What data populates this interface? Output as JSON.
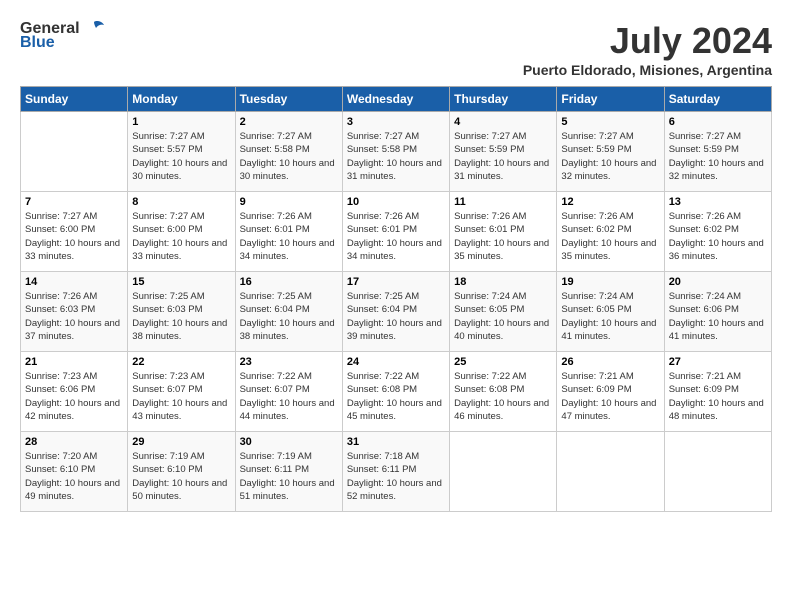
{
  "logo": {
    "general": "General",
    "blue": "Blue"
  },
  "title": "July 2024",
  "location": "Puerto Eldorado, Misiones, Argentina",
  "days_of_week": [
    "Sunday",
    "Monday",
    "Tuesday",
    "Wednesday",
    "Thursday",
    "Friday",
    "Saturday"
  ],
  "weeks": [
    [
      {
        "day": "",
        "sunrise": "",
        "sunset": "",
        "daylight": ""
      },
      {
        "day": "1",
        "sunrise": "Sunrise: 7:27 AM",
        "sunset": "Sunset: 5:57 PM",
        "daylight": "Daylight: 10 hours and 30 minutes."
      },
      {
        "day": "2",
        "sunrise": "Sunrise: 7:27 AM",
        "sunset": "Sunset: 5:58 PM",
        "daylight": "Daylight: 10 hours and 30 minutes."
      },
      {
        "day": "3",
        "sunrise": "Sunrise: 7:27 AM",
        "sunset": "Sunset: 5:58 PM",
        "daylight": "Daylight: 10 hours and 31 minutes."
      },
      {
        "day": "4",
        "sunrise": "Sunrise: 7:27 AM",
        "sunset": "Sunset: 5:59 PM",
        "daylight": "Daylight: 10 hours and 31 minutes."
      },
      {
        "day": "5",
        "sunrise": "Sunrise: 7:27 AM",
        "sunset": "Sunset: 5:59 PM",
        "daylight": "Daylight: 10 hours and 32 minutes."
      },
      {
        "day": "6",
        "sunrise": "Sunrise: 7:27 AM",
        "sunset": "Sunset: 5:59 PM",
        "daylight": "Daylight: 10 hours and 32 minutes."
      }
    ],
    [
      {
        "day": "7",
        "sunrise": "Sunrise: 7:27 AM",
        "sunset": "Sunset: 6:00 PM",
        "daylight": "Daylight: 10 hours and 33 minutes."
      },
      {
        "day": "8",
        "sunrise": "Sunrise: 7:27 AM",
        "sunset": "Sunset: 6:00 PM",
        "daylight": "Daylight: 10 hours and 33 minutes."
      },
      {
        "day": "9",
        "sunrise": "Sunrise: 7:26 AM",
        "sunset": "Sunset: 6:01 PM",
        "daylight": "Daylight: 10 hours and 34 minutes."
      },
      {
        "day": "10",
        "sunrise": "Sunrise: 7:26 AM",
        "sunset": "Sunset: 6:01 PM",
        "daylight": "Daylight: 10 hours and 34 minutes."
      },
      {
        "day": "11",
        "sunrise": "Sunrise: 7:26 AM",
        "sunset": "Sunset: 6:01 PM",
        "daylight": "Daylight: 10 hours and 35 minutes."
      },
      {
        "day": "12",
        "sunrise": "Sunrise: 7:26 AM",
        "sunset": "Sunset: 6:02 PM",
        "daylight": "Daylight: 10 hours and 35 minutes."
      },
      {
        "day": "13",
        "sunrise": "Sunrise: 7:26 AM",
        "sunset": "Sunset: 6:02 PM",
        "daylight": "Daylight: 10 hours and 36 minutes."
      }
    ],
    [
      {
        "day": "14",
        "sunrise": "Sunrise: 7:26 AM",
        "sunset": "Sunset: 6:03 PM",
        "daylight": "Daylight: 10 hours and 37 minutes."
      },
      {
        "day": "15",
        "sunrise": "Sunrise: 7:25 AM",
        "sunset": "Sunset: 6:03 PM",
        "daylight": "Daylight: 10 hours and 38 minutes."
      },
      {
        "day": "16",
        "sunrise": "Sunrise: 7:25 AM",
        "sunset": "Sunset: 6:04 PM",
        "daylight": "Daylight: 10 hours and 38 minutes."
      },
      {
        "day": "17",
        "sunrise": "Sunrise: 7:25 AM",
        "sunset": "Sunset: 6:04 PM",
        "daylight": "Daylight: 10 hours and 39 minutes."
      },
      {
        "day": "18",
        "sunrise": "Sunrise: 7:24 AM",
        "sunset": "Sunset: 6:05 PM",
        "daylight": "Daylight: 10 hours and 40 minutes."
      },
      {
        "day": "19",
        "sunrise": "Sunrise: 7:24 AM",
        "sunset": "Sunset: 6:05 PM",
        "daylight": "Daylight: 10 hours and 41 minutes."
      },
      {
        "day": "20",
        "sunrise": "Sunrise: 7:24 AM",
        "sunset": "Sunset: 6:06 PM",
        "daylight": "Daylight: 10 hours and 41 minutes."
      }
    ],
    [
      {
        "day": "21",
        "sunrise": "Sunrise: 7:23 AM",
        "sunset": "Sunset: 6:06 PM",
        "daylight": "Daylight: 10 hours and 42 minutes."
      },
      {
        "day": "22",
        "sunrise": "Sunrise: 7:23 AM",
        "sunset": "Sunset: 6:07 PM",
        "daylight": "Daylight: 10 hours and 43 minutes."
      },
      {
        "day": "23",
        "sunrise": "Sunrise: 7:22 AM",
        "sunset": "Sunset: 6:07 PM",
        "daylight": "Daylight: 10 hours and 44 minutes."
      },
      {
        "day": "24",
        "sunrise": "Sunrise: 7:22 AM",
        "sunset": "Sunset: 6:08 PM",
        "daylight": "Daylight: 10 hours and 45 minutes."
      },
      {
        "day": "25",
        "sunrise": "Sunrise: 7:22 AM",
        "sunset": "Sunset: 6:08 PM",
        "daylight": "Daylight: 10 hours and 46 minutes."
      },
      {
        "day": "26",
        "sunrise": "Sunrise: 7:21 AM",
        "sunset": "Sunset: 6:09 PM",
        "daylight": "Daylight: 10 hours and 47 minutes."
      },
      {
        "day": "27",
        "sunrise": "Sunrise: 7:21 AM",
        "sunset": "Sunset: 6:09 PM",
        "daylight": "Daylight: 10 hours and 48 minutes."
      }
    ],
    [
      {
        "day": "28",
        "sunrise": "Sunrise: 7:20 AM",
        "sunset": "Sunset: 6:10 PM",
        "daylight": "Daylight: 10 hours and 49 minutes."
      },
      {
        "day": "29",
        "sunrise": "Sunrise: 7:19 AM",
        "sunset": "Sunset: 6:10 PM",
        "daylight": "Daylight: 10 hours and 50 minutes."
      },
      {
        "day": "30",
        "sunrise": "Sunrise: 7:19 AM",
        "sunset": "Sunset: 6:11 PM",
        "daylight": "Daylight: 10 hours and 51 minutes."
      },
      {
        "day": "31",
        "sunrise": "Sunrise: 7:18 AM",
        "sunset": "Sunset: 6:11 PM",
        "daylight": "Daylight: 10 hours and 52 minutes."
      },
      {
        "day": "",
        "sunrise": "",
        "sunset": "",
        "daylight": ""
      },
      {
        "day": "",
        "sunrise": "",
        "sunset": "",
        "daylight": ""
      },
      {
        "day": "",
        "sunrise": "",
        "sunset": "",
        "daylight": ""
      }
    ]
  ]
}
